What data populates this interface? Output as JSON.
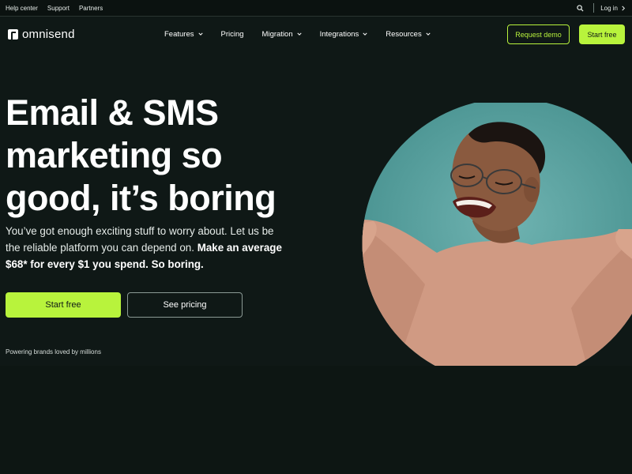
{
  "topbar": {
    "links": [
      "Help center",
      "Support",
      "Partners"
    ],
    "login_label": "Log in",
    "search_icon": "search-icon"
  },
  "brand": {
    "name": "omnisend",
    "accent": "#b8f33c",
    "background": "#0f1816"
  },
  "nav": {
    "items": [
      {
        "label": "Features",
        "dropdown": true
      },
      {
        "label": "Pricing",
        "dropdown": false
      },
      {
        "label": "Migration",
        "dropdown": true
      },
      {
        "label": "Integrations",
        "dropdown": true
      },
      {
        "label": "Resources",
        "dropdown": true
      }
    ],
    "request_demo_label": "Request demo",
    "start_free_label": "Start free"
  },
  "hero": {
    "title_lines": [
      "Email & SMS",
      "marketing so",
      "good, it’s boring"
    ],
    "subtitle_plain": "You’ve got enough exciting stuff to worry about. Let us be the reliable platform you can depend on.",
    "subtitle_strong": "Make an average $68* for every $1 you spend. So boring.",
    "start_free_label": "Start free",
    "see_pricing_label": "See pricing",
    "powering_text": "Powering brands loved by millions"
  }
}
